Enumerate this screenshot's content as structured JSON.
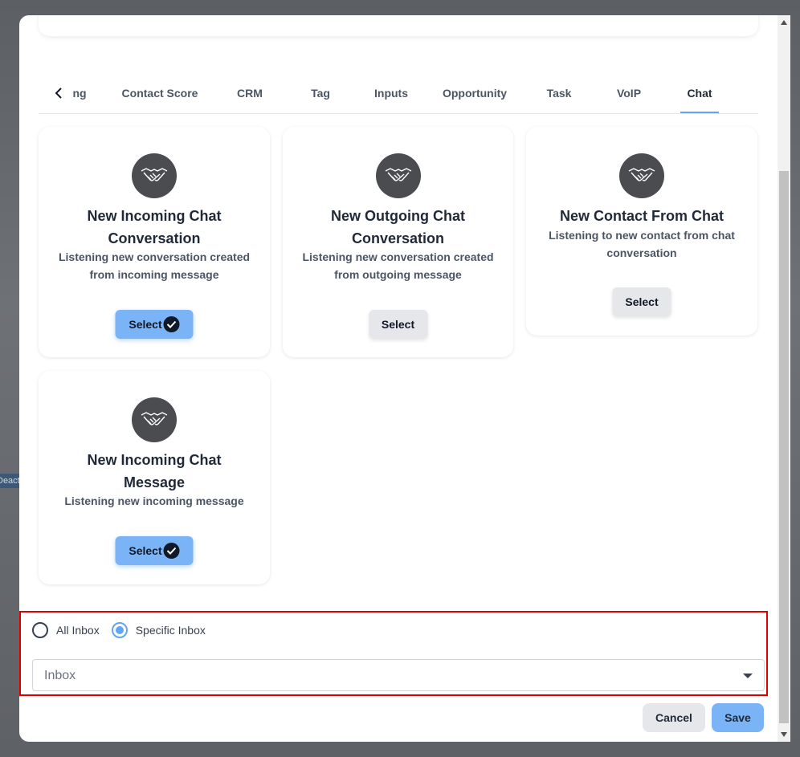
{
  "background": {
    "partial_label": "Deact"
  },
  "tabs": {
    "items": [
      {
        "label": "ng"
      },
      {
        "label": "Contact Score"
      },
      {
        "label": "CRM"
      },
      {
        "label": "Tag"
      },
      {
        "label": "Inputs"
      },
      {
        "label": "Opportunity"
      },
      {
        "label": "Task"
      },
      {
        "label": "VoIP"
      },
      {
        "label": "Chat",
        "active": true
      }
    ]
  },
  "cards": [
    {
      "title": "New Incoming Chat Conversation",
      "description": "Listening new conversation created from incoming message",
      "button": "Select",
      "selected": true,
      "icon": "handshake-icon"
    },
    {
      "title": "New Outgoing Chat Conversation",
      "description": "Listening new conversation created from outgoing message",
      "button": "Select",
      "selected": false,
      "icon": "handshake-icon"
    },
    {
      "title": "New Contact From Chat",
      "description": "Listening to new contact from chat conversation",
      "button": "Select",
      "selected": false,
      "icon": "handshake-icon"
    },
    {
      "title": "New Incoming Chat Message",
      "description": "Listening new incoming message",
      "button": "Select",
      "selected": true,
      "icon": "handshake-icon"
    }
  ],
  "inbox": {
    "options": [
      {
        "label": "All Inbox",
        "checked": false
      },
      {
        "label": "Specific Inbox",
        "checked": true
      }
    ],
    "select_placeholder": "Inbox"
  },
  "footer": {
    "cancel_label": "Cancel",
    "save_label": "Save"
  },
  "colors": {
    "accent": "#7ab4f7",
    "icon_bg": "#4b4c50",
    "highlight_border": "#e00000"
  }
}
